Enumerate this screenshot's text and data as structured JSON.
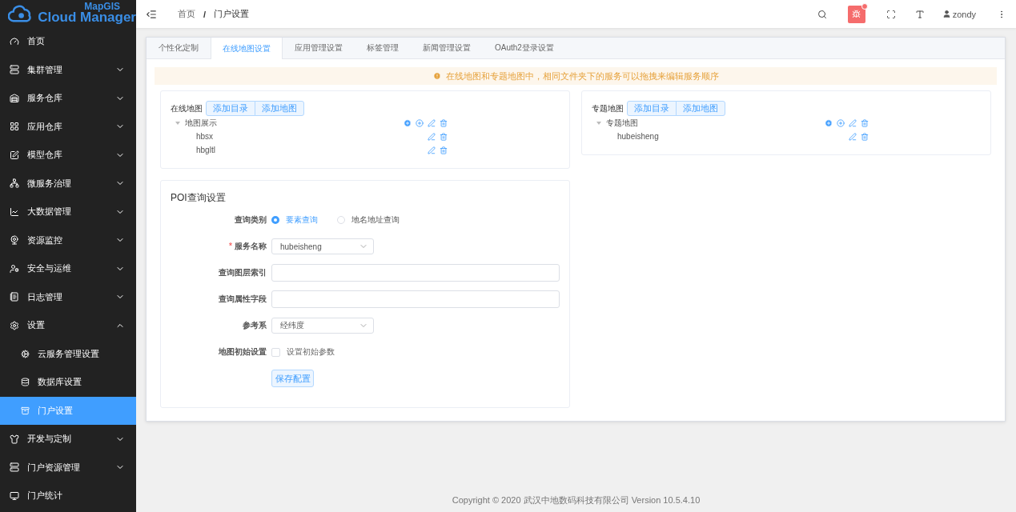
{
  "logo": {
    "brand": "MapGIS",
    "product": "Cloud Manager"
  },
  "sidebar": {
    "items": [
      {
        "label": "首页",
        "kind": "link"
      },
      {
        "label": "集群管理",
        "kind": "group",
        "expanded": false
      },
      {
        "label": "服务仓库",
        "kind": "group",
        "expanded": false
      },
      {
        "label": "应用仓库",
        "kind": "group",
        "expanded": false
      },
      {
        "label": "模型仓库",
        "kind": "group",
        "expanded": false
      },
      {
        "label": "微服务治理",
        "kind": "group",
        "expanded": false
      },
      {
        "label": "大数据管理",
        "kind": "group",
        "expanded": false
      },
      {
        "label": "资源监控",
        "kind": "group",
        "expanded": false
      },
      {
        "label": "安全与运维",
        "kind": "group",
        "expanded": false
      },
      {
        "label": "日志管理",
        "kind": "group",
        "expanded": false
      },
      {
        "label": "设置",
        "kind": "group",
        "expanded": true,
        "children": [
          {
            "label": "云服务管理设置",
            "selected": false
          },
          {
            "label": "数据库设置",
            "selected": false
          },
          {
            "label": "门户设置",
            "selected": true
          }
        ]
      },
      {
        "label": "开发与定制",
        "kind": "group",
        "expanded": false
      },
      {
        "label": "门户资源管理",
        "kind": "group",
        "expanded": false
      },
      {
        "label": "门户统计",
        "kind": "link"
      }
    ]
  },
  "header": {
    "breadcrumb": [
      "首页",
      "门户设置"
    ],
    "separator": "/",
    "user": "zondy",
    "notification": true
  },
  "tabs": [
    {
      "label": "个性化定制",
      "selected": false
    },
    {
      "label": "在线地图设置",
      "selected": true
    },
    {
      "label": "应用管理设置",
      "selected": false
    },
    {
      "label": "标签管理",
      "selected": false
    },
    {
      "label": "新闻管理设置",
      "selected": false
    },
    {
      "label": "OAuth2登录设置",
      "selected": false
    }
  ],
  "notice": "在线地图和专题地图中，相同文件夹下的服务可以拖拽来编辑服务顺序",
  "map_panels": [
    {
      "title": "在线地图",
      "buttons": [
        "添加目录",
        "添加地图"
      ],
      "tree": [
        {
          "label": "地图展示",
          "kind": "folder",
          "expanded": true,
          "children": [
            {
              "label": "hbsx",
              "kind": "item"
            },
            {
              "label": "hbgltl",
              "kind": "item"
            }
          ]
        }
      ]
    },
    {
      "title": "专题地图",
      "buttons": [
        "添加目录",
        "添加地图"
      ],
      "tree": [
        {
          "label": "专题地图",
          "kind": "folder",
          "expanded": true,
          "children": [
            {
              "label": "hubeisheng",
              "kind": "item"
            }
          ]
        }
      ]
    }
  ],
  "poi": {
    "title": "POI查询设置",
    "rows": [
      {
        "kind": "radio",
        "label": "查询类别",
        "options": [
          {
            "label": "要素查询",
            "selected": true
          },
          {
            "label": "地名地址查询",
            "selected": false
          }
        ]
      },
      {
        "kind": "select",
        "label": "服务名称",
        "required_mark": "*",
        "value": "hubeisheng"
      },
      {
        "kind": "input",
        "label": "查询图层索引"
      },
      {
        "kind": "input",
        "label": "查询属性字段"
      },
      {
        "kind": "select",
        "label": "参考系",
        "value": "经纬度"
      },
      {
        "kind": "checkbox",
        "label": "地图初始设置",
        "option": "设置初始参数",
        "checked": false
      },
      {
        "kind": "button",
        "button": "保存配置"
      }
    ]
  },
  "footer": "Copyright © 2020 武汉中地数码科技有限公司 Version 10.5.4.10"
}
